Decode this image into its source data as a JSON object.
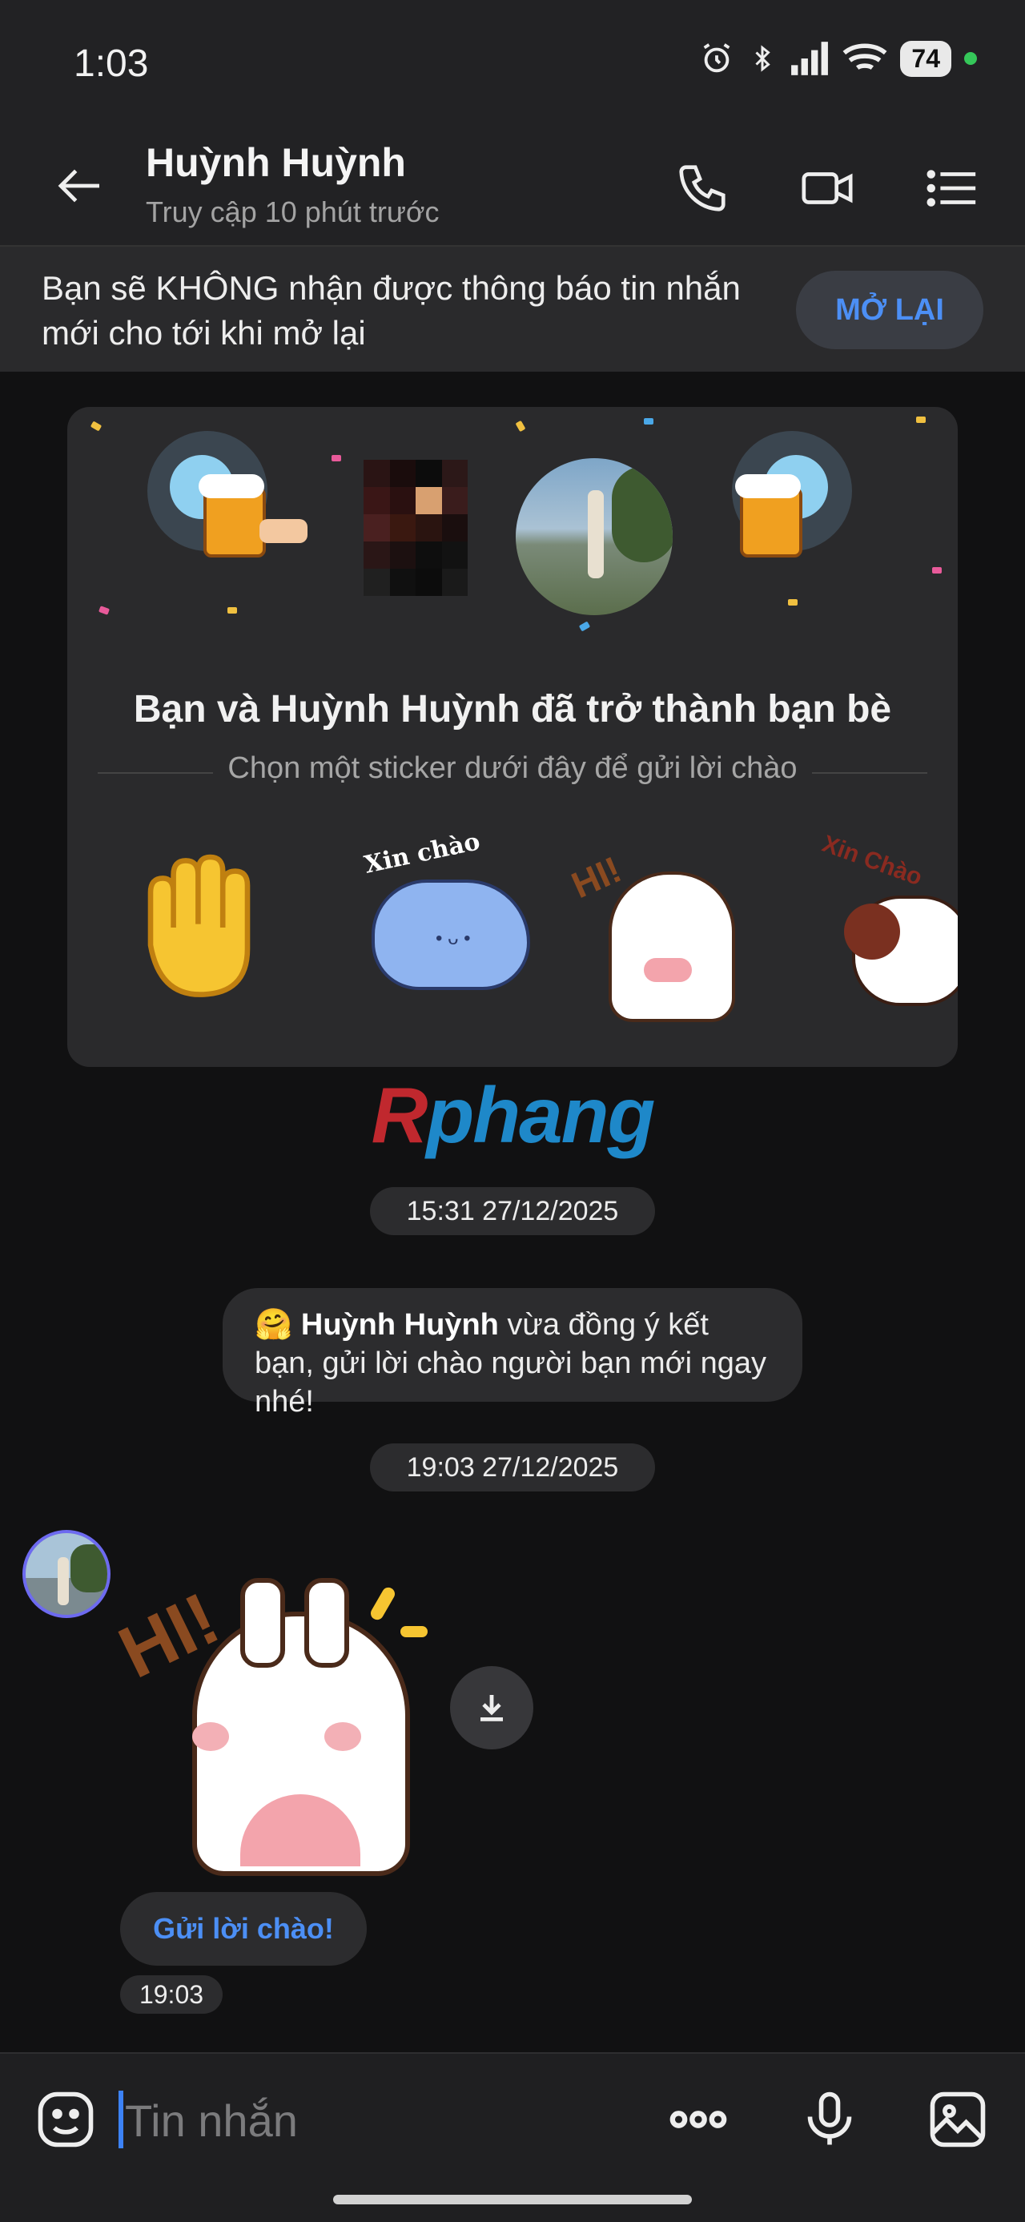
{
  "status_bar": {
    "time": "1:03",
    "battery": "74"
  },
  "header": {
    "contact_name": "Huỳnh Huỳnh",
    "last_seen": "Truy cập 10 phút trước"
  },
  "mute_banner": {
    "text": "Bạn sẽ KHÔNG nhận được thông báo tin nhắn mới cho tới khi mở lại",
    "button": "MỞ LẠI"
  },
  "friend_card": {
    "title": "Bạn và Huỳnh Huỳnh đã trở thành bạn bè",
    "subtitle": "Chọn một sticker dưới đây để gửi lời chào",
    "stickers": [
      "waving-hand",
      "xin-chao-blob",
      "hi-bunny",
      "xin-chao-dog"
    ],
    "sticker_texts": [
      "Xin chào",
      "HI!",
      "Xin Chào"
    ]
  },
  "watermark": {
    "part1": "R",
    "part2": "phang"
  },
  "messages": {
    "timestamp_1": "15:31 27/12/2025",
    "system_name": "Huỳnh Huỳnh",
    "system_rest": " vừa đồng ý kết bạn, gửi lời chào người bạn mới ngay nhé!",
    "system_emoji": "🤗",
    "timestamp_2": "19:03 27/12/2025",
    "sticker_hi": "HI!",
    "greet_button": "Gửi lời chào!",
    "message_time": "19:03"
  },
  "composer": {
    "placeholder": "Tin nhắn"
  },
  "colors": {
    "accent": "#4c8ff5",
    "background": "#111112"
  }
}
